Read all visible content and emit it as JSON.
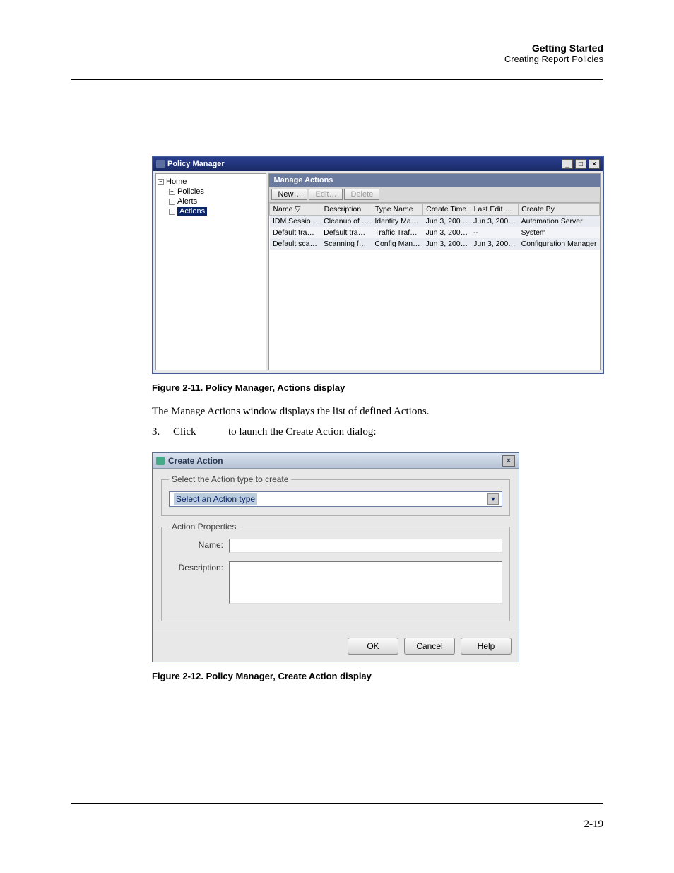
{
  "header": {
    "title": "Getting Started",
    "subtitle": "Creating Report Policies"
  },
  "pm": {
    "title": "Policy Manager",
    "tree": {
      "home": "Home",
      "policies": "Policies",
      "alerts": "Alerts",
      "actions": "Actions"
    },
    "panel_title": "Manage Actions",
    "toolbar": {
      "new": "New…",
      "edit": "Edit…",
      "delete": "Delete"
    },
    "cols": [
      "Name  ▽",
      "Description",
      "Type Name",
      "Create Time",
      "Last Edit …",
      "Create By"
    ],
    "rows": [
      [
        "IDM Sessio…",
        "Cleanup of …",
        "Identity Ma…",
        "Jun 3, 200…",
        "Jun 3, 200…",
        "Automation Server"
      ],
      [
        "Default tra…",
        "Default tra…",
        "Traffic:Traf…",
        "Jun 3, 200…",
        "--",
        "System"
      ],
      [
        "Default sca…",
        "Scanning f…",
        "Config Man…",
        "Jun 3, 200…",
        "Jun 3, 200…",
        "Configuration Manager"
      ]
    ]
  },
  "caption1": "Figure 2-11. Policy Manager, Actions display",
  "body1": "The Manage Actions window displays the list of defined Actions.",
  "step3": {
    "num": "3.",
    "a": "Click",
    "b": "to launch the Create Action dialog:"
  },
  "ca": {
    "title": "Create Action",
    "legend1": "Select the Action type to create",
    "select_placeholder": "Select an Action type",
    "legend2": "Action Properties",
    "name_label": "Name:",
    "desc_label": "Description:",
    "ok": "OK",
    "cancel": "Cancel",
    "help": "Help"
  },
  "caption2": "Figure 2-12. Policy Manager, Create Action display",
  "page_number": "2-19"
}
